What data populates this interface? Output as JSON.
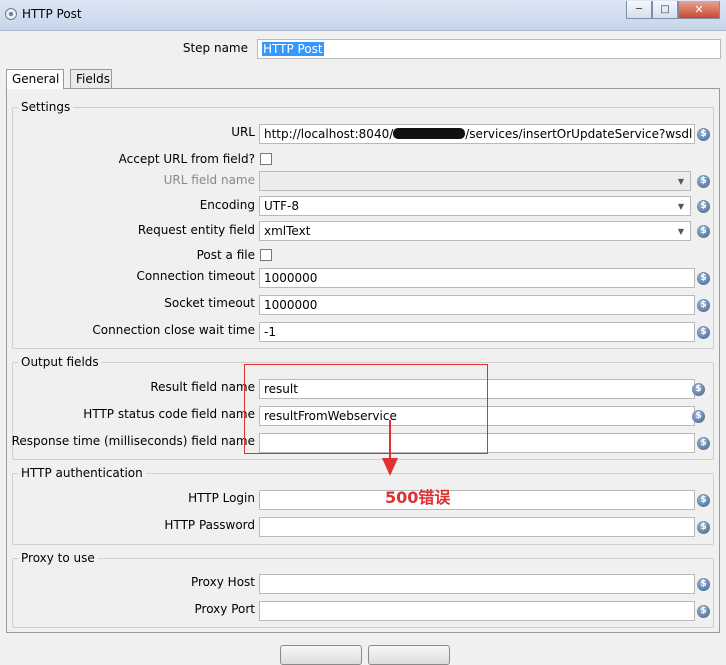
{
  "window": {
    "title": "HTTP Post",
    "minimize_glyph": "─",
    "maximize_glyph": "□",
    "close_glyph": "✕"
  },
  "step": {
    "label": "Step name",
    "value": "HTTP Post"
  },
  "tabs": [
    {
      "label": "General",
      "active": true
    },
    {
      "label": "Fields",
      "active": false
    }
  ],
  "settings": {
    "legend": "Settings",
    "url": {
      "label": "URL",
      "value_prefix": "http://localhost:8040/",
      "value_suffix": "/services/insertOrUpdateService?wsdl"
    },
    "accept_url_from_field": {
      "label": "Accept URL from field?",
      "checked": false
    },
    "url_field_name": {
      "label": "URL field name",
      "value": "",
      "disabled": true
    },
    "encoding": {
      "label": "Encoding",
      "value": "UTF-8"
    },
    "request_entity_field": {
      "label": "Request entity field",
      "value": "xmlText"
    },
    "post_a_file": {
      "label": "Post a file",
      "checked": false
    },
    "connection_timeout": {
      "label": "Connection timeout",
      "value": "1000000"
    },
    "socket_timeout": {
      "label": "Socket timeout",
      "value": "1000000"
    },
    "connection_close_wait_time": {
      "label": "Connection close wait time",
      "value": "-1"
    }
  },
  "output_fields": {
    "legend": "Output fields",
    "result_field_name": {
      "label": "Result field name",
      "value": "result"
    },
    "http_status_code_field_name": {
      "label": "HTTP status code field name",
      "value": "resultFromWebservice"
    },
    "response_time_field_name": {
      "label": "Response time (milliseconds) field name",
      "value": ""
    }
  },
  "http_auth": {
    "legend": "HTTP authentication",
    "login": {
      "label": "HTTP Login",
      "value": ""
    },
    "password": {
      "label": "HTTP Password",
      "value": ""
    }
  },
  "proxy": {
    "legend": "Proxy to use",
    "host": {
      "label": "Proxy Host",
      "value": ""
    },
    "port": {
      "label": "Proxy Port",
      "value": ""
    }
  },
  "annotation": {
    "text": "500错误",
    "color": "#e03030"
  },
  "icons": {
    "variable": "variable-dollar-icon",
    "combo": "chevron-down-icon"
  },
  "variable_glyph": "$",
  "combo_glyph": "▼",
  "colors": {
    "selection": "#3399ff",
    "annotation": "#e03030",
    "variable_icon": "#3e5f8c"
  }
}
